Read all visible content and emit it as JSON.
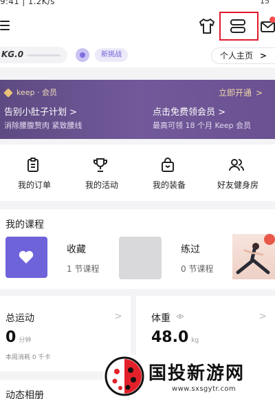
{
  "statusbar": {
    "time": "9:41 | 1.2K/s",
    "right": "15"
  },
  "header": {
    "icons": [
      "menu-icon",
      "shirt-icon",
      "scan-icon",
      "mail-icon"
    ]
  },
  "level": {
    "label": "KG.0",
    "challenge": "新挑战",
    "profile": "个人主页",
    "profile_chevron": ">"
  },
  "banner": {
    "brand": "keep · 会员",
    "open": "立即开通",
    "open_chevron": ">",
    "title1": "告别小肚子计划 >",
    "sub1": "消除腰腹赘肉 紧致腰线",
    "title2": "点击免费领会员 >",
    "sub2": "最高可领 18 个月 Keep 会员"
  },
  "quick": {
    "items": [
      {
        "label": "我的订单",
        "icon": "clipboard-icon"
      },
      {
        "label": "我的活动",
        "icon": "trophy-icon"
      },
      {
        "label": "我的装备",
        "icon": "bag-icon"
      },
      {
        "label": "好友健身房",
        "icon": "friends-icon"
      }
    ]
  },
  "courses": {
    "title": "我的课程",
    "favorite": {
      "title": "收藏",
      "count": "1 节课程"
    },
    "done": {
      "title": "练过",
      "count": "0 节课程"
    }
  },
  "stats": {
    "total": {
      "title": "总运动",
      "value": "0",
      "unit": "分钟",
      "note": "本周消耗 0 千卡",
      "chevron": ">"
    },
    "weight": {
      "title": "体重",
      "value": "48.0",
      "unit": "kg",
      "chevron": ">"
    }
  },
  "bottom": {
    "title": "动态相册"
  },
  "watermark": {
    "cn": "国投新游网",
    "en": "www.sxsgytr.com"
  },
  "colors": {
    "accent": "#6e63d9",
    "banner": "#6a5190",
    "highlight": "#e0192c"
  }
}
